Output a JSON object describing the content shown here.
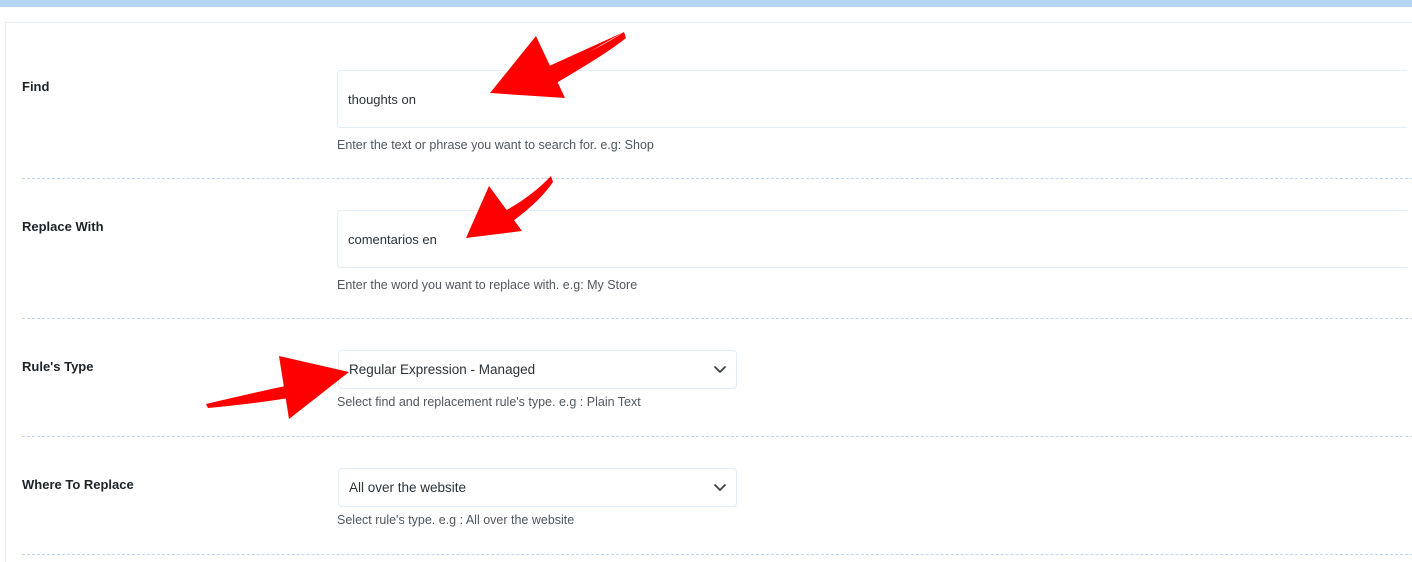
{
  "fields": {
    "find": {
      "label": "Find",
      "value": "thoughts on",
      "help": "Enter the text or phrase you want to search for. e.g: Shop"
    },
    "replace": {
      "label": "Replace With",
      "value": "comentarios en",
      "help": "Enter the word you want to replace with. e.g: My Store"
    },
    "rule_type": {
      "label": "Rule's Type",
      "selected": "Regular Expression - Managed",
      "help": "Select find and replacement rule's type. e.g : Plain Text"
    },
    "where": {
      "label": "Where To Replace",
      "selected": "All over the website",
      "help": "Select rule's type. e.g : All over the website"
    }
  },
  "icons": {
    "chevron": "chevron-down-icon",
    "annotation": "red-arrow"
  },
  "colors": {
    "top_strip": "#b6d4f3",
    "arrow": "#ff0000",
    "separator": "#c3d7e8"
  }
}
